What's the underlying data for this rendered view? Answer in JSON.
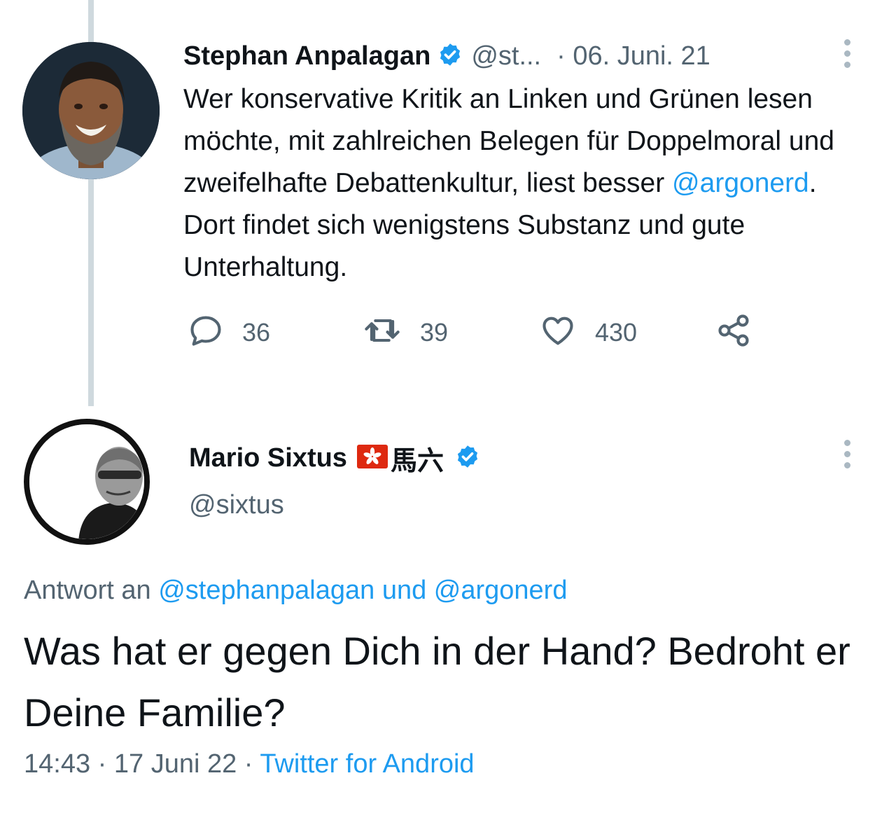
{
  "tweet1": {
    "name": "Stephan Anpalagan",
    "handle": "@st...",
    "date": "· 06. Juni. 21",
    "text_before": "Wer konservative Kritik an Linken und Grünen lesen möchte, mit zahlreichen Belegen für Doppelmoral und zweifelhafte Debattenkultur, liest besser ",
    "mention": "@argonerd",
    "text_after": ". Dort findet sich wenigstens Substanz und gute Unterhaltung.",
    "replies": "36",
    "retweets": "39",
    "likes": "430",
    "icons": [
      "reply-icon",
      "retweet-icon",
      "like-icon",
      "share-icon",
      "verified-icon",
      "more-icon"
    ]
  },
  "tweet2": {
    "name": "Mario Sixtus",
    "name_cjk": "馬六",
    "handle": "@sixtus",
    "replying_prefix": "Antwort an ",
    "replying_to": "@stephanpalagan und @argonerd",
    "text": "Was hat er gegen Dich in der Hand? Bedroht er Deine Familie?",
    "time": "14:43 · 17 Juni 22 · ",
    "source": "Twitter for Android"
  },
  "colors": {
    "accent": "#1d9bf0",
    "secondary_text": "#536471",
    "primary_text": "#0f1419",
    "thread_line": "#cfd9de"
  }
}
